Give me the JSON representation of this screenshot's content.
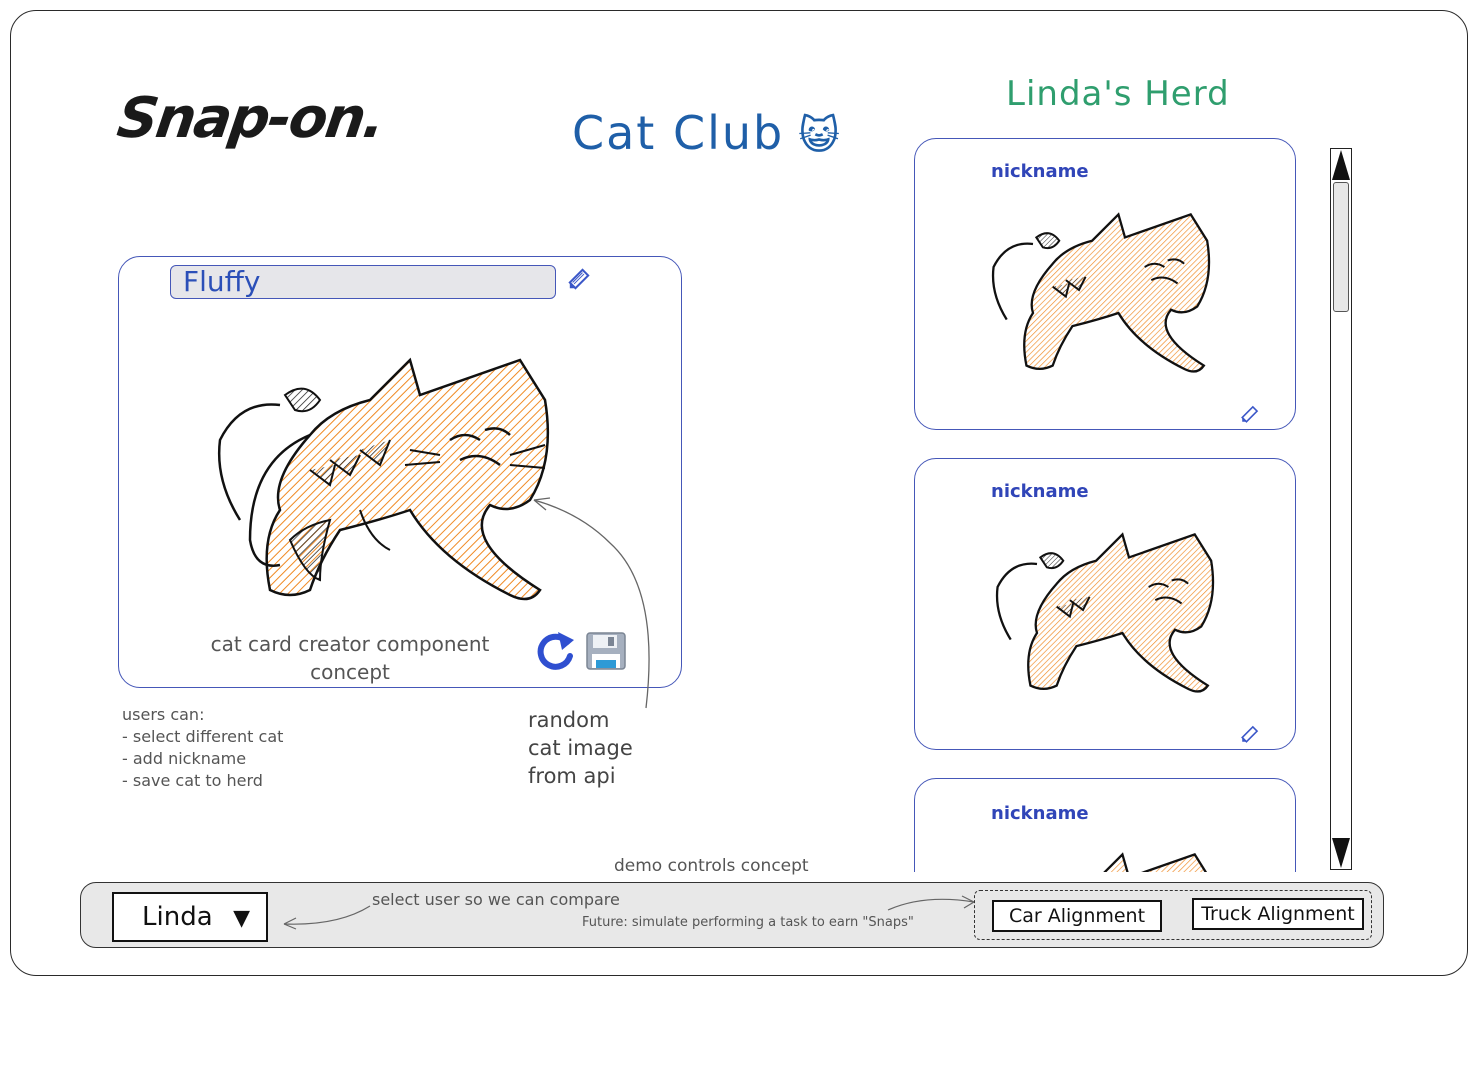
{
  "app": {
    "brand": "Snap-on.",
    "title": "Cat Club",
    "title_emoji": "😺"
  },
  "creator": {
    "nickname_value": "Fluffy",
    "caption_line1": "cat card creator component",
    "caption_line2": "concept",
    "edit_icon": "pencil-icon",
    "refresh_icon": "refresh-icon",
    "save_icon": "floppy-disk-icon"
  },
  "notes": {
    "users_can": "users can:\n- select different cat\n- add nickname\n- save cat to herd",
    "api": "random\ncat image\nfrom api"
  },
  "herd": {
    "title": "Linda's Herd",
    "cards": [
      {
        "nickname": "nickname"
      },
      {
        "nickname": "nickname"
      },
      {
        "nickname": "nickname"
      }
    ]
  },
  "demo": {
    "label": "demo controls concept",
    "selected_user": "Linda",
    "select_note": "select user so we can compare",
    "future_note": "Future: simulate performing a task to earn \"Snaps\"",
    "task_buttons": [
      "Car Alignment",
      "Truck Alignment"
    ]
  },
  "colors": {
    "accent_blue": "#1f5fa8",
    "herd_green": "#2f9e6e",
    "card_border": "#4557b8",
    "cat_fill": "#f08a24"
  }
}
